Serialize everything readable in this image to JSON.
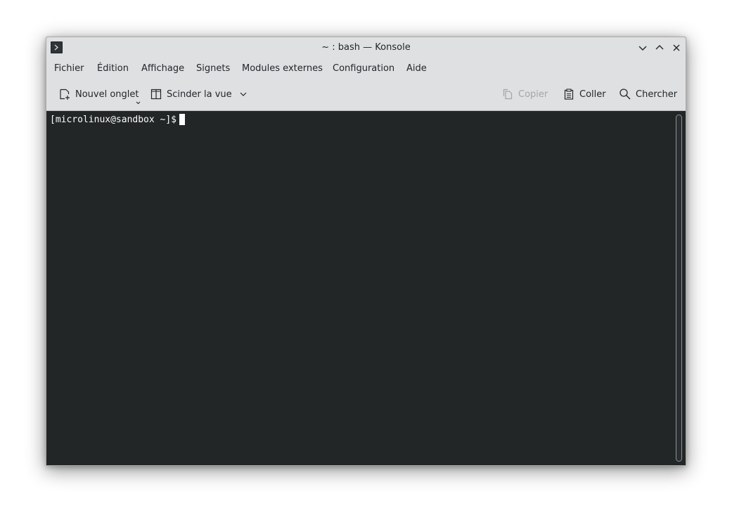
{
  "window": {
    "title": "~ : bash — Konsole"
  },
  "titlebar": {
    "app_icon": "terminal-icon",
    "buttons": [
      "minimize-icon",
      "maximize-icon",
      "close-icon"
    ]
  },
  "menubar": {
    "items": [
      {
        "label": "Fichier"
      },
      {
        "label": "Édition"
      },
      {
        "label": "Affichage"
      },
      {
        "label": "Signets"
      },
      {
        "label": "Modules externes"
      },
      {
        "label": "Configuration"
      },
      {
        "label": "Aide"
      }
    ]
  },
  "toolbar": {
    "new_tab": {
      "label": "Nouvel onglet",
      "icon": "new-tab-icon"
    },
    "split_view": {
      "label": "Scinder la vue",
      "icon": "split-view-icon"
    },
    "copy": {
      "label": "Copier",
      "icon": "copy-icon",
      "enabled": false
    },
    "paste": {
      "label": "Coller",
      "icon": "paste-icon"
    },
    "search": {
      "label": "Chercher",
      "icon": "search-icon"
    }
  },
  "terminal": {
    "prompt": "[microlinux@sandbox ~]$",
    "background": "#232627",
    "foreground": "#fcfcfc"
  }
}
